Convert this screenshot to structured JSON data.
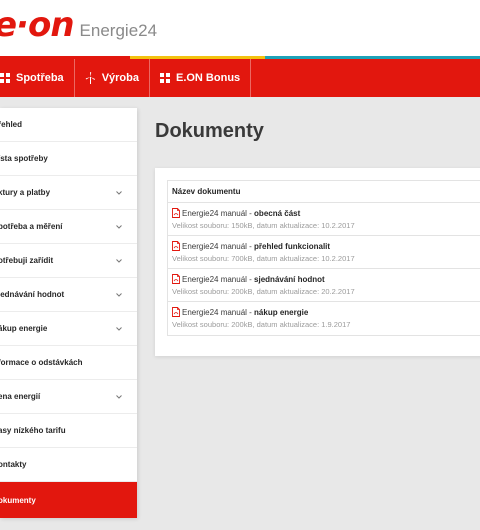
{
  "header": {
    "logo_text": "e·on",
    "product_name": "Energie24"
  },
  "topnav": {
    "items": [
      {
        "label": "Spotřeba",
        "icon": "grid-icon"
      },
      {
        "label": "Výroba",
        "icon": "wind-turbine-icon"
      },
      {
        "label": "E.ON Bonus",
        "icon": "grid-icon"
      }
    ]
  },
  "sidebar": {
    "items": [
      {
        "label": "řehled",
        "has_chevron": false
      },
      {
        "label": "ísta spotřeby",
        "has_chevron": false
      },
      {
        "label": "ktury a platby",
        "has_chevron": true
      },
      {
        "label": "potřeba a měření",
        "has_chevron": true
      },
      {
        "label": "otřebuji zařídit",
        "has_chevron": true
      },
      {
        "label": "jednávání hodnot",
        "has_chevron": true
      },
      {
        "label": "ákup energie",
        "has_chevron": true
      },
      {
        "label": "formace o odstávkách",
        "has_chevron": false
      },
      {
        "label": "ena energií",
        "has_chevron": true
      },
      {
        "label": "asy nízkého tarifu",
        "has_chevron": false
      },
      {
        "label": "ontakty",
        "has_chevron": false
      },
      {
        "label": "okumenty",
        "has_chevron": false,
        "active": true
      }
    ]
  },
  "main": {
    "title": "Dokumenty",
    "table": {
      "header": "Název dokumentu",
      "rows": [
        {
          "prefix": "Energie24 manuál - ",
          "bold": "obecná část",
          "meta": "Velikost souboru: 150kB, datum aktualizace: 10.2.2017"
        },
        {
          "prefix": "Energie24 manuál - ",
          "bold": "přehled funkcionalit",
          "meta": "Velikost souboru: 700kB, datum aktualizace: 10.2.2017"
        },
        {
          "prefix": "Energie24 manuál - ",
          "bold": "sjednávání hodnot",
          "meta": "Velikost souboru: 200kB, datum aktualizace: 20.2.2017"
        },
        {
          "prefix": "Energie24 manuál - ",
          "bold": "nákup energie",
          "meta": "Velikost souboru: 200kB, datum aktualizace: 1.9.2017"
        }
      ]
    }
  },
  "colors": {
    "brand_red": "#e2170e",
    "stripe_yellow": "#f3c20f",
    "stripe_blue": "#1ea2b8",
    "background": "#e8e8e8"
  }
}
